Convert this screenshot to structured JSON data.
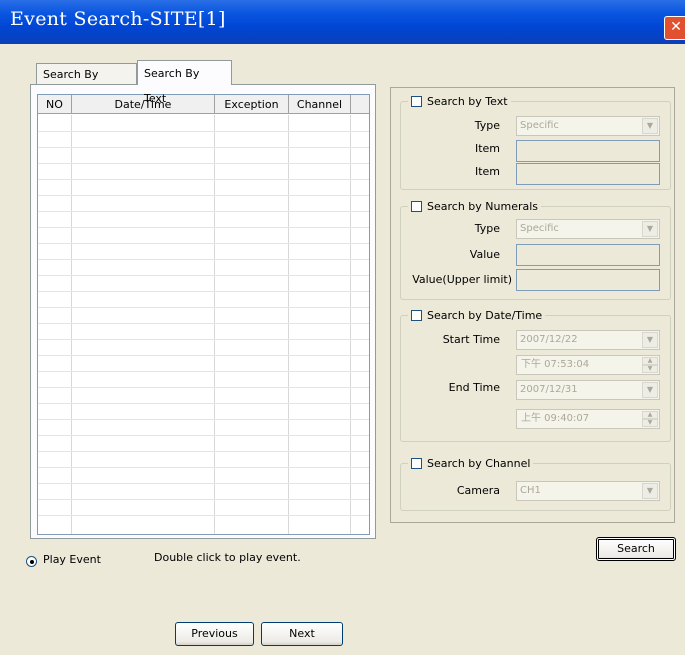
{
  "window": {
    "title": "Event Search-SITE[1]"
  },
  "tabs": [
    {
      "label": "Search By Event",
      "active": false
    },
    {
      "label": "Search By Text",
      "active": true
    }
  ],
  "table": {
    "columns": [
      "NO",
      "Date/Time",
      "Exception",
      "Channel"
    ],
    "rows": []
  },
  "play_event": {
    "label": "Play Event",
    "selected": true,
    "hint": "Double click to play event."
  },
  "search_by_text": {
    "label": "Search by Text",
    "checked": false,
    "type_label": "Type",
    "type_value": "Specific",
    "item_label_1": "Item",
    "item_label_2": "Item"
  },
  "search_by_numerals": {
    "label": "Search by Numerals",
    "checked": false,
    "type_label": "Type",
    "type_value": "Specific",
    "value_label": "Value",
    "upper_label": "Value(Upper limit)"
  },
  "search_by_datetime": {
    "label": "Search by Date/Time",
    "checked": false,
    "start_label": "Start Time",
    "start_date": "2007/12/22",
    "start_time": "下午 07:53:04",
    "end_label": "End Time",
    "end_date": "2007/12/31",
    "end_time": "上午 09:40:07"
  },
  "search_by_channel": {
    "label": "Search by Channel",
    "checked": false,
    "camera_label": "Camera",
    "camera_value": "CH1"
  },
  "buttons": {
    "search": "Search",
    "previous": "Previous",
    "next": "Next"
  },
  "icons": {
    "close": "close-icon",
    "dropdown": "chevron-down-icon"
  },
  "colors": {
    "titlebar": "#0a56e0",
    "face": "#ece9d8",
    "close": "#e2512f"
  }
}
